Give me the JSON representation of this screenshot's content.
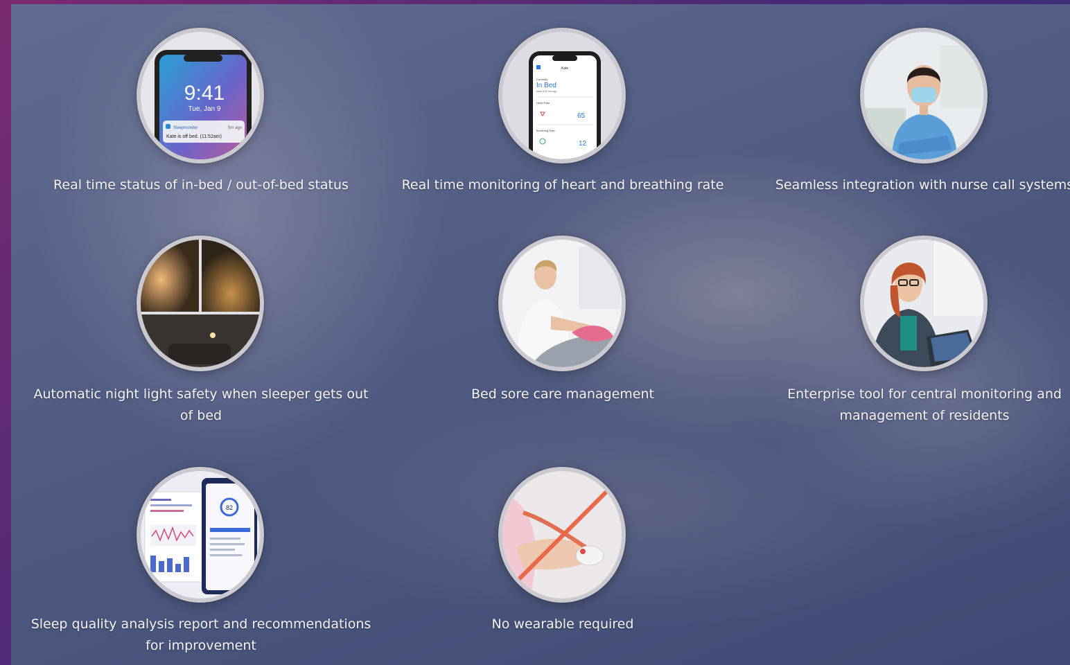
{
  "features": [
    {
      "id": "in-bed-status",
      "icon": "phone-lockscreen-icon",
      "caption": "Real time status of in-bed / out-of-bed status",
      "screen": {
        "time": "9:41",
        "date": "Tue, Jan 9",
        "app": "Sleepmonitor",
        "when": "5m ago",
        "message": "Kate is off bed. (11:52am)"
      }
    },
    {
      "id": "heart-breathing",
      "icon": "phone-app-vitals-icon",
      "caption": "Real time monitoring of heart and breathing rate",
      "screen": {
        "title": "Kate",
        "status_label": "Currently",
        "status": "In Bed",
        "sub": "since 8:02 min ago",
        "heart_label": "Heart Rate",
        "heart_value": "65",
        "breath_label": "Breathing Rate",
        "breath_value": "12"
      }
    },
    {
      "id": "nurse-call",
      "icon": "nurse-photo-icon",
      "caption": "Seamless integration with nurse call systems"
    },
    {
      "id": "night-light",
      "icon": "night-light-photo-icon",
      "caption": "Automatic night light safety when sleeper gets out of bed"
    },
    {
      "id": "bed-sore",
      "icon": "caregiver-photo-icon",
      "caption": "Bed sore care management"
    },
    {
      "id": "enterprise-tool",
      "icon": "laptop-worker-photo-icon",
      "caption": "Enterprise tool for central monitoring and management of residents"
    },
    {
      "id": "sleep-report",
      "icon": "sleep-report-screens-icon",
      "caption": "Sleep quality analysis report and recommendations for improvement",
      "screen": {
        "score": "82"
      }
    },
    {
      "id": "no-wearable",
      "icon": "no-wearable-icon",
      "caption": "No wearable required"
    }
  ]
}
